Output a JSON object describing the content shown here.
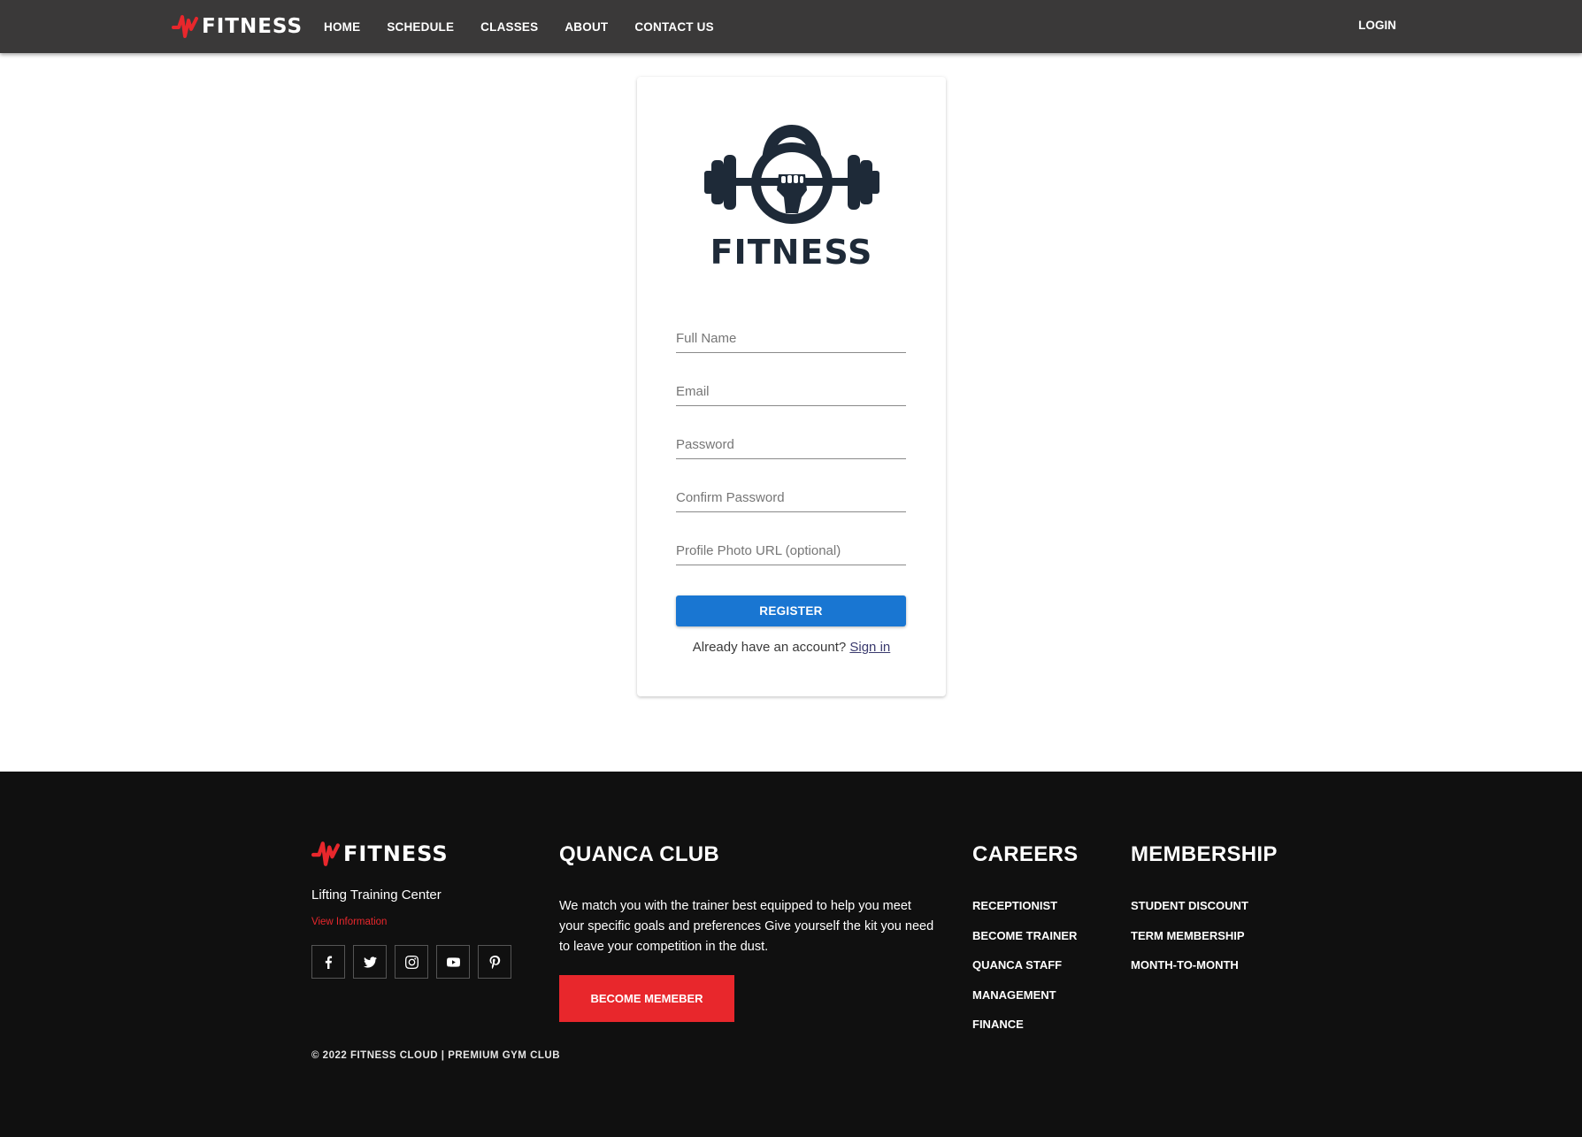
{
  "nav": {
    "logo_text": "FITNESS",
    "links": [
      "HOME",
      "SCHEDULE",
      "CLASSES",
      "ABOUT",
      "CONTACT US"
    ],
    "login": "LOGIN"
  },
  "card": {
    "logo_text": "FITNESS",
    "fields": {
      "full_name": "Full Name",
      "email": "Email",
      "password": "Password",
      "confirm_password": "Confirm Password",
      "photo_url": "Profile Photo URL (optional)"
    },
    "register_label": "REGISTER",
    "signin_prompt": "Already have an account?",
    "signin_link": "Sign in"
  },
  "footer": {
    "logo_text": "FITNESS",
    "tagline": "Lifting Training Center",
    "view_info": "View Information",
    "socials": [
      "facebook-icon",
      "twitter-icon",
      "instagram-icon",
      "youtube-icon",
      "pinterest-icon"
    ],
    "club": {
      "heading": "QUANCA CLUB",
      "text": "We match you with the trainer best equipped to help you meet your specific goals and preferences Give yourself the kit you need to leave your competition in the dust.",
      "button": "BECOME MEMEBER"
    },
    "careers": {
      "heading": "CAREERS",
      "items": [
        "RECEPTIONIST",
        "BECOME TRAINER",
        "QUANCA STAFF",
        "MANAGEMENT",
        "FINANCE"
      ]
    },
    "membership": {
      "heading": "MEMBERSHIP",
      "items": [
        "STUDENT DISCOUNT",
        "TERM MEMBERSHIP",
        "MONTH-TO-MONTH"
      ]
    },
    "copyright": "© 2022 FITNESS CLOUD | PREMIUM GYM CLUB"
  },
  "colors": {
    "navbar": "#3a3939",
    "accent_red": "#e8272c",
    "primary_blue": "#1976d2",
    "footer_bg": "#101010",
    "logo_navy": "#1e2a38"
  }
}
